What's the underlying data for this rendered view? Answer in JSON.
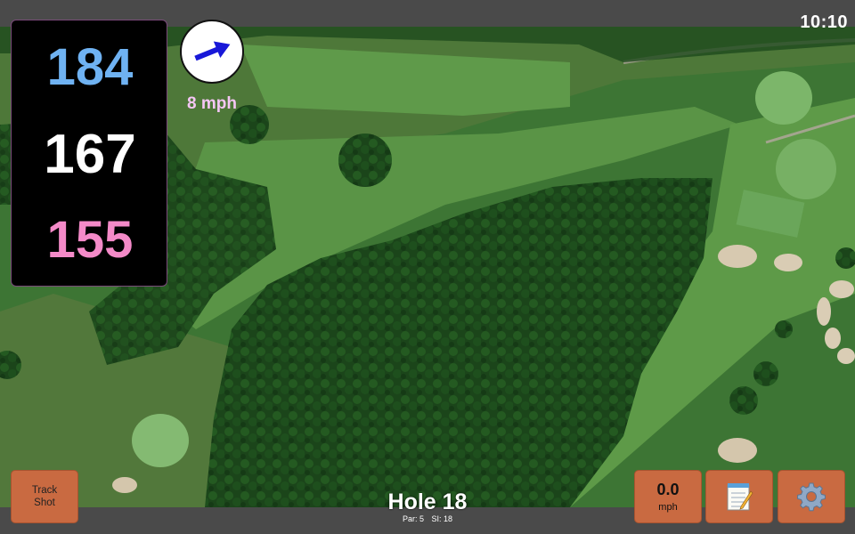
{
  "status_bar": {
    "time": "10:10"
  },
  "distances": {
    "back": "184",
    "middle": "167",
    "front": "155"
  },
  "colors": {
    "back": "#6fb2f2",
    "middle": "#ffffff",
    "front": "#f48ac8",
    "button": "#c96a41",
    "wind_arrow": "#1818d8"
  },
  "wind": {
    "speed_label": "8 mph",
    "icon": "arrow-icon",
    "direction": "north-east"
  },
  "buttons": {
    "track_shot_line1": "Track",
    "track_shot_line2": "Shot",
    "speed_value": "0.0",
    "speed_unit": "mph",
    "notes_icon": "notepad-icon",
    "settings_icon": "gear-icon"
  },
  "hole": {
    "title": "Hole 18",
    "par": "Par: 5",
    "si": "SI: 18"
  }
}
